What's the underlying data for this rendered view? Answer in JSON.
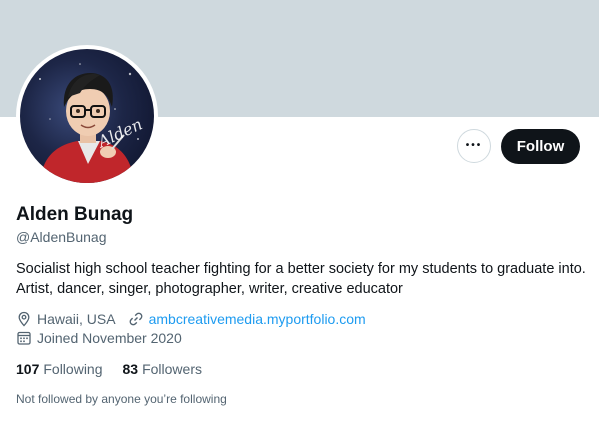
{
  "profile": {
    "name": "Alden Bunag",
    "handle": "@AldenBunag",
    "bio": "Socialist high school teacher fighting for a better society for my students to graduate into. Artist, dancer, singer, photographer, writer, creative educator",
    "location": "Hawaii, USA",
    "website": "ambcreativemedia.myportfolio.com",
    "joined": "Joined November 2020",
    "avatar_signature": "Alden"
  },
  "stats": {
    "following_count": "107",
    "following_label": "Following",
    "followers_count": "83",
    "followers_label": "Followers"
  },
  "actions": {
    "more_label": "•••",
    "follow_label": "Follow"
  },
  "social_context": "Not followed by anyone you’re following",
  "icons": {
    "location": "location-pin-icon",
    "website": "link-icon",
    "joined": "calendar-icon"
  },
  "colors": {
    "banner": "#cfd9de",
    "link": "#1d9bf0",
    "follow_button": "#0f1419"
  }
}
